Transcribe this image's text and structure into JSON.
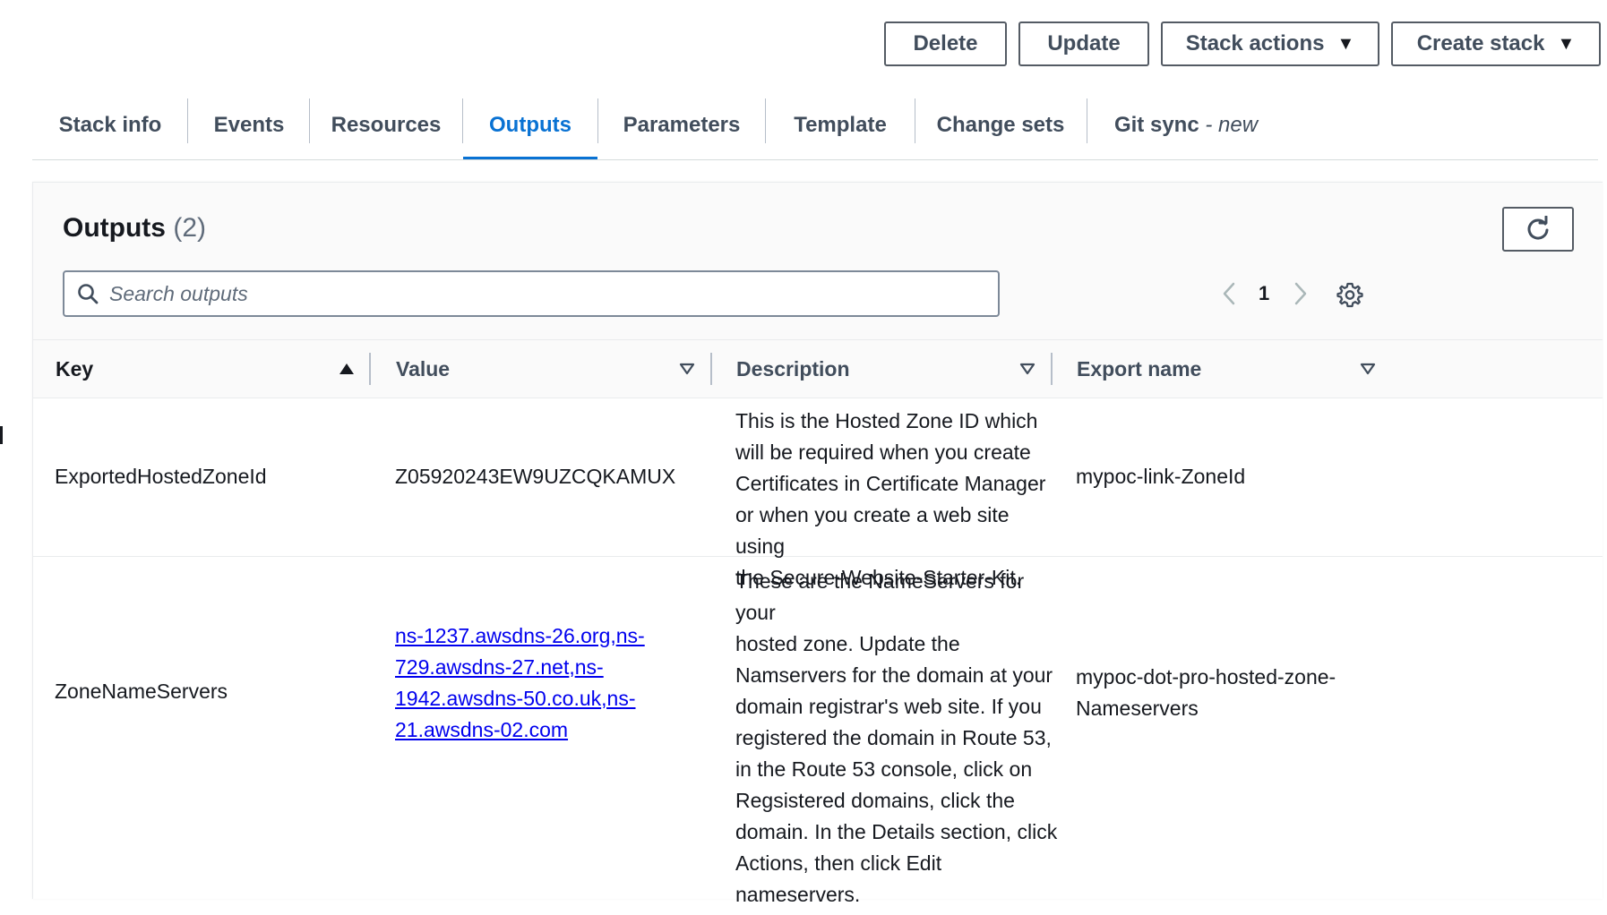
{
  "actions": {
    "delete": "Delete",
    "update": "Update",
    "stack_actions": "Stack actions",
    "create_stack": "Create stack"
  },
  "tabs": [
    {
      "label": "Stack info"
    },
    {
      "label": "Events"
    },
    {
      "label": "Resources"
    },
    {
      "label": "Outputs",
      "active": true
    },
    {
      "label": "Parameters"
    },
    {
      "label": "Template"
    },
    {
      "label": "Change sets"
    },
    {
      "label": "Git sync",
      "suffix": "- new"
    }
  ],
  "outputs": {
    "title": "Outputs",
    "count": "(2)",
    "search_placeholder": "Search outputs",
    "page": "1",
    "columns": {
      "key": "Key",
      "value": "Value",
      "description": "Description",
      "export_name": "Export name"
    },
    "rows": [
      {
        "key": "ExportedHostedZoneId",
        "value": "Z05920243EW9UZCQKAMUX",
        "description_lines": [
          "This is the Hosted Zone ID which",
          "will be required when you create",
          "Certificates in Certificate Manager",
          "or when you create a web site using",
          "the Secure-Website-Starter-Kit."
        ],
        "export_name": "mypoc-link-ZoneId"
      },
      {
        "key": "ZoneNameServers",
        "value_lines": [
          {
            "a": "ns-1237.awsdns-26.org",
            "b": ",",
            "c": "ns-"
          },
          {
            "a": "729.awsdns-27.net",
            "b": ",",
            "c": "ns-"
          },
          {
            "a": "1942.awsdns-50.co.uk",
            "b": ",",
            "c": "ns-"
          },
          {
            "a": "21.awsdns-02.com",
            "b": "",
            "c": ""
          }
        ],
        "description_lines": [
          "These are the NameServers for your",
          "hosted zone. Update the",
          "Namservers for the domain at your",
          "domain registrar's web site. If you",
          "registered the domain in Route 53,",
          "in the Route 53 console, click on",
          "Regsistered domains, click the",
          "domain. In the Details section, click",
          "Actions, then click Edit nameservers."
        ],
        "export_name_lines": [
          "mypoc-dot-pro-hosted-zone-",
          "Nameservers"
        ]
      }
    ]
  },
  "colors": {
    "accent": "#0972d3",
    "link": "#0000ee",
    "text": "#16191f",
    "muted": "#414d5c"
  }
}
